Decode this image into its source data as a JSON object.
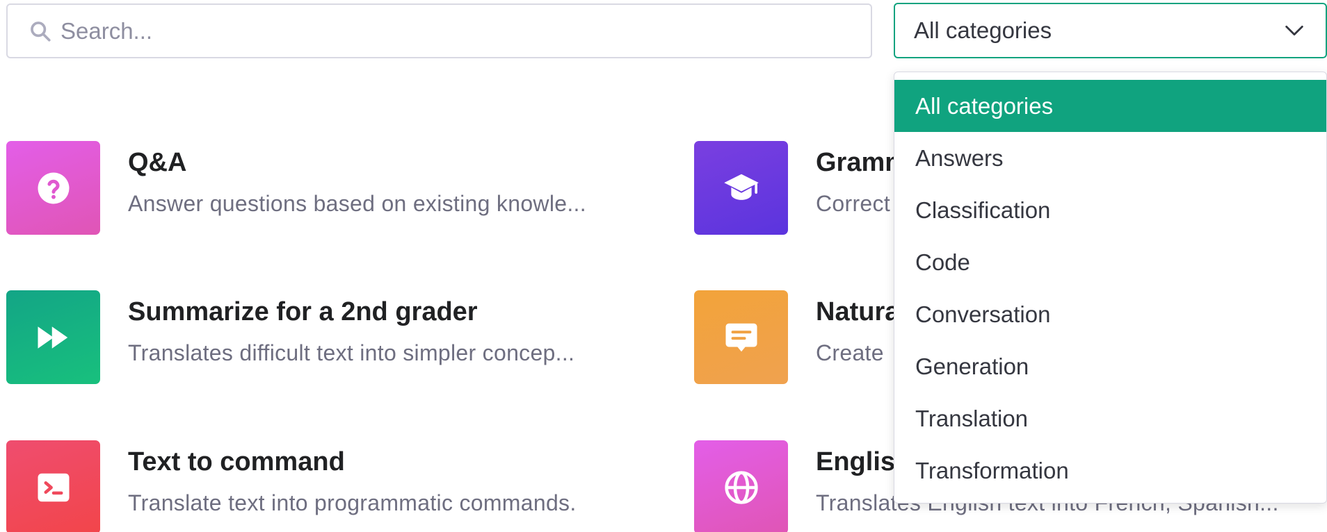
{
  "search": {
    "placeholder": "Search...",
    "value": ""
  },
  "category_select": {
    "selected": "All categories",
    "options": [
      "All categories",
      "Answers",
      "Classification",
      "Code",
      "Conversation",
      "Generation",
      "Translation",
      "Transformation"
    ]
  },
  "cards": [
    {
      "title": "Q&A",
      "description": "Answer questions based on existing knowle...",
      "icon": "question-circle-icon",
      "color": "#e058d0"
    },
    {
      "title": "Summarize for a 2nd grader",
      "description": "Translates difficult text into simpler concep...",
      "icon": "fast-forward-icon",
      "color": "#16b083"
    },
    {
      "title": "Text to command",
      "description": "Translate text into programmatic commands.",
      "icon": "terminal-icon",
      "color": "#f0495c"
    },
    {
      "title": "Gramm",
      "description": "Correct",
      "icon": "graduation-cap-icon",
      "color": "#6a3adf"
    },
    {
      "title": "Natura",
      "description": "Create",
      "icon": "chat-bubble-icon",
      "color": "#f1a345"
    },
    {
      "title": "Englis",
      "description": "Translates English text into French, Spanish...",
      "icon": "globe-icon",
      "color": "#e058d0"
    }
  ],
  "colors": {
    "accent": "#10a37f",
    "border": "#d9d9e3",
    "muted_text": "#6e6e80"
  }
}
